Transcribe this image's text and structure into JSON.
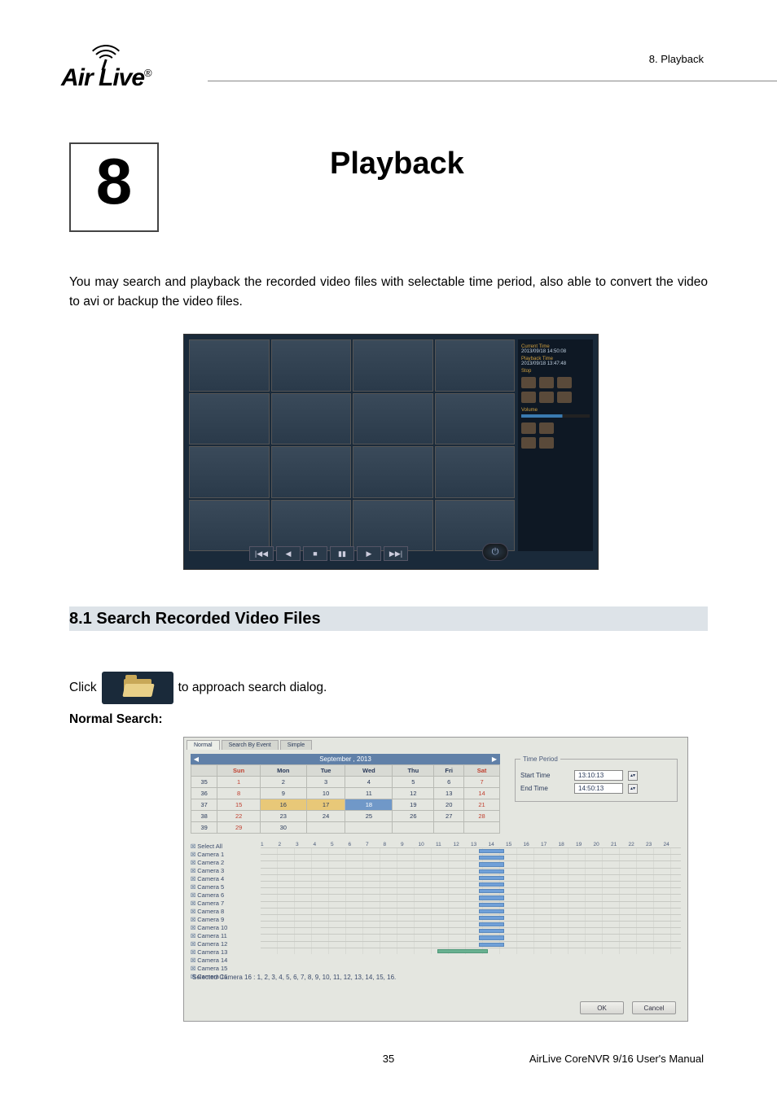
{
  "breadcrumb": "8. Playback",
  "logo": {
    "text": "Air Live",
    "reg": "®"
  },
  "chapter": {
    "number": "8",
    "title": "Playback"
  },
  "intro": "You may search and playback the recorded video files with selectable time period, also able to convert the video to avi or backup the video files.",
  "fig1": {
    "side": {
      "current_time_label": "Current Time",
      "current_time": "2013/09/18 14:50:08",
      "playback_time_label": "Playback Time",
      "playback_time": "2013/09/18 13:47:48",
      "stop": "Stop",
      "volume": "Volume"
    },
    "transport": [
      "|◀◀",
      "◀",
      "■",
      "▮▮",
      "▶",
      "▶▶|"
    ]
  },
  "section_8_1": "8.1 Search Recorded Video Files",
  "click_before": "Click",
  "click_after": "to approach search dialog.",
  "normal_search": "Normal Search:",
  "fig2": {
    "tabs": [
      "Normal",
      "Search By Event",
      "Simple"
    ],
    "month": {
      "label": "September",
      "year": "2013",
      "left": "◀",
      "right": "▶"
    },
    "dow": [
      "Sun",
      "Mon",
      "Tue",
      "Wed",
      "Thu",
      "Fri",
      "Sat"
    ],
    "weeks": [
      [
        "35",
        "1",
        "2",
        "3",
        "4",
        "5",
        "6",
        "7"
      ],
      [
        "36",
        "8",
        "9",
        "10",
        "11",
        "12",
        "13",
        "14"
      ],
      [
        "37",
        "15",
        "16",
        "17",
        "18",
        "19",
        "20",
        "21"
      ],
      [
        "38",
        "22",
        "23",
        "24",
        "25",
        "26",
        "27",
        "28"
      ],
      [
        "39",
        "29",
        "30",
        "",
        "",
        "",
        "",
        ""
      ]
    ],
    "period": {
      "legend": "Time Period",
      "start_label": "Start Time",
      "start_value": "13:10:13",
      "end_label": "End Time",
      "end_value": "14:50:13"
    },
    "select_all": "Select All",
    "hours": [
      "1",
      "2",
      "3",
      "4",
      "5",
      "6",
      "7",
      "8",
      "9",
      "10",
      "11",
      "12",
      "13",
      "14",
      "15",
      "16",
      "17",
      "18",
      "19",
      "20",
      "21",
      "22",
      "23",
      "24"
    ],
    "cameras": [
      "Camera 1",
      "Camera 2",
      "Camera 3",
      "Camera 4",
      "Camera 5",
      "Camera 6",
      "Camera 7",
      "Camera 8",
      "Camera 9",
      "Camera 10",
      "Camera 11",
      "Camera 12",
      "Camera 13",
      "Camera 14",
      "Camera 15",
      "Camera 16"
    ],
    "selected_line": "Selected Camera 16 : 1, 2, 3, 4, 5, 6, 7, 8, 9, 10, 11, 12, 13, 14, 15, 16.",
    "ok": "OK",
    "cancel": "Cancel"
  },
  "footer": {
    "page": "35",
    "manual": "AirLive CoreNVR 9/16 User's Manual"
  }
}
